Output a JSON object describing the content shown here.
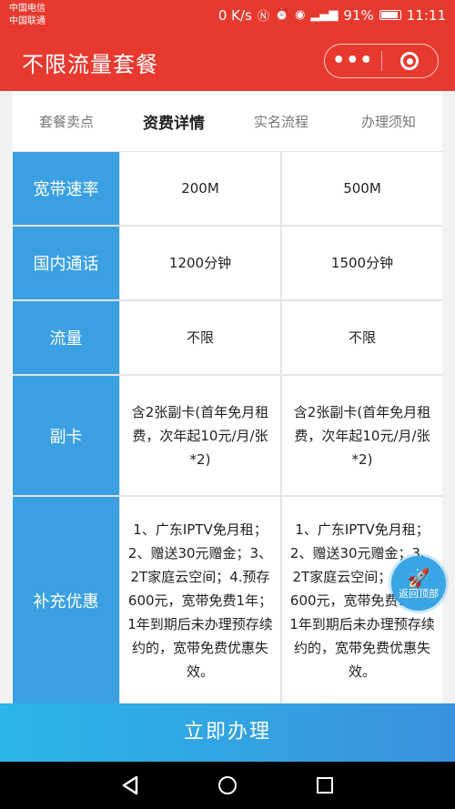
{
  "status": {
    "carrier1": "中国电信",
    "carrier2": "中国联通",
    "speed": "0 K/s",
    "battery": "91%",
    "time": "11:11"
  },
  "header": {
    "title": "不限流量套餐",
    "more_label": "•••"
  },
  "tabs": [
    {
      "label": "套餐卖点"
    },
    {
      "label": "资费详情"
    },
    {
      "label": "实名流程"
    },
    {
      "label": "办理须知"
    }
  ],
  "table": {
    "rows": [
      {
        "head": "宽带速率",
        "c1": "200M",
        "c2": "500M"
      },
      {
        "head": "国内通话",
        "c1": "1200分钟",
        "c2": "1500分钟"
      },
      {
        "head": "流量",
        "c1": "不限",
        "c2": "不限"
      },
      {
        "head": "副卡",
        "c1": "含2张副卡(首年免月租费，次年起10元/月/张*2)",
        "c2": "含2张副卡(首年免月租费，次年起10元/月/张*2)"
      },
      {
        "head": "补充优惠",
        "c1": "1、广东IPTV免月租；2、赠送30元赠金；3、2T家庭云空间；4.预存600元，宽带免费1年；1年到期后未办理预存续约的，宽带免费优惠失效。",
        "c2": "1、广东IPTV免月租；2、赠送30元赠金；3、2T家庭云空间；4.预存600元，宽带免费1年；1年到期后未办理预存续约的，宽带免费优惠失效。"
      }
    ]
  },
  "back_to_top": "返回顶部",
  "cta_label": "立即办理"
}
